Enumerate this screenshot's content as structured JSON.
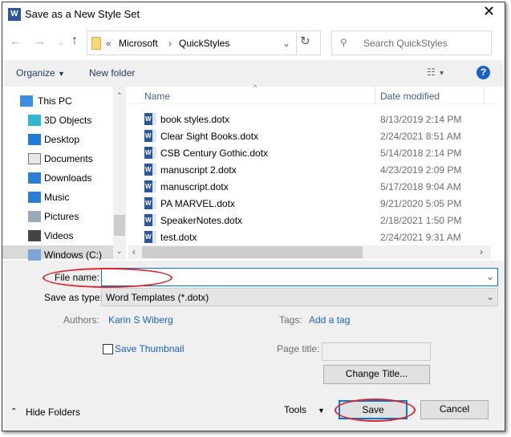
{
  "title": "Save as a New Style Set",
  "address": {
    "path": [
      "Microsoft",
      "QuickStyles"
    ],
    "search_placeholder": "Search QuickStyles"
  },
  "toolbar": {
    "organize": "Organize",
    "new_folder": "New folder"
  },
  "nav_pane": {
    "items": [
      {
        "label": "This PC",
        "icon": "computer-icon"
      },
      {
        "label": "3D Objects",
        "icon": "cube-icon"
      },
      {
        "label": "Desktop",
        "icon": "desktop-icon"
      },
      {
        "label": "Documents",
        "icon": "document-icon"
      },
      {
        "label": "Downloads",
        "icon": "download-icon"
      },
      {
        "label": "Music",
        "icon": "music-icon"
      },
      {
        "label": "Pictures",
        "icon": "picture-icon"
      },
      {
        "label": "Videos",
        "icon": "video-icon"
      },
      {
        "label": "Windows (C:)",
        "icon": "drive-icon",
        "selected": true
      }
    ]
  },
  "file_list": {
    "columns": [
      "Name",
      "Date modified"
    ],
    "files": [
      {
        "name": "book styles.dotx",
        "date": "8/13/2019 2:14 PM"
      },
      {
        "name": "Clear Sight Books.dotx",
        "date": "2/24/2021 8:51 AM"
      },
      {
        "name": "CSB Century Gothic.dotx",
        "date": "5/14/2018 2:14 PM"
      },
      {
        "name": "manuscript 2.dotx",
        "date": "4/23/2019 2:09 PM"
      },
      {
        "name": "manuscript.dotx",
        "date": "5/17/2018 9:04 AM"
      },
      {
        "name": "PA MARVEL.dotx",
        "date": "9/21/2020 5:05 PM"
      },
      {
        "name": "SpeakerNotes.dotx",
        "date": "2/18/2021 1:50 PM"
      },
      {
        "name": "test.dotx",
        "date": "2/24/2021 9:31 AM"
      }
    ]
  },
  "form": {
    "file_name_label": "File name:",
    "file_name_value": "",
    "save_type_label": "Save as type:",
    "save_type_value": "Word Templates (*.dotx)",
    "authors_label": "Authors:",
    "authors_value": "Karin S Wiberg",
    "tags_label": "Tags:",
    "tags_value": "Add a tag",
    "save_thumbnail": "Save Thumbnail",
    "page_title_label": "Page title:",
    "page_title_value": "",
    "change_title": "Change Title..."
  },
  "footer": {
    "hide_folders": "Hide Folders",
    "tools": "Tools",
    "save": "Save",
    "cancel": "Cancel"
  },
  "colors": {
    "accent": "#0078d7",
    "link": "#1a63c6",
    "annotation": "#d9282f"
  }
}
